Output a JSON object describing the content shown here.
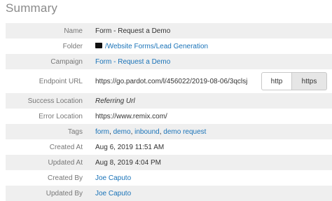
{
  "title": "Summary",
  "rows": {
    "name": {
      "label": "Name",
      "value": "Form - Request a Demo"
    },
    "folder": {
      "label": "Folder",
      "value": "/Website Forms/Lead Generation"
    },
    "campaign": {
      "label": "Campaign",
      "value": "Form - Request a Demo"
    },
    "endpoint": {
      "label": "Endpoint URL",
      "value": "https://go.pardot.com/l/456022/2019-08-06/3qclsj",
      "http_label": "http",
      "https_label": "https"
    },
    "success": {
      "label": "Success Location",
      "value": "Referring Url"
    },
    "error": {
      "label": "Error Location",
      "value": "https://www.remix.com/"
    },
    "tags": {
      "label": "Tags",
      "items": [
        "form",
        "demo",
        "inbound",
        "demo request"
      ]
    },
    "created_at": {
      "label": "Created At",
      "value": "Aug 6, 2019 11:51 AM"
    },
    "updated_at": {
      "label": "Updated At",
      "value": "Aug 8, 2019 4:04 PM"
    },
    "created_by": {
      "label": "Created By",
      "value": "Joe Caputo"
    },
    "updated_by": {
      "label": "Updated By",
      "value": "Joe Caputo"
    }
  },
  "colors": {
    "link": "#1a73b8",
    "shaded_row": "#efefef",
    "label": "#777777"
  },
  "icons": {
    "folder": "folder-icon"
  }
}
